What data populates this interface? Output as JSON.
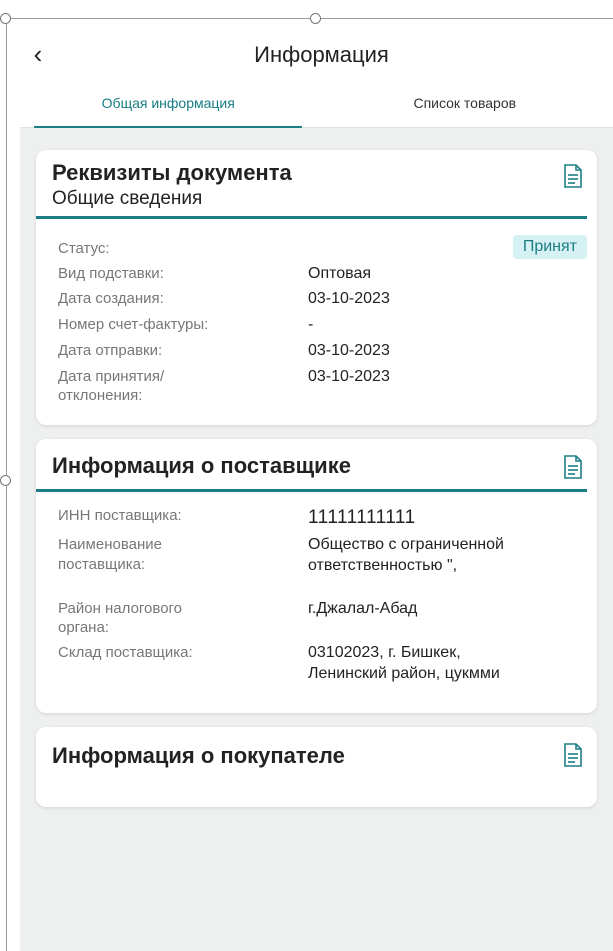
{
  "header": {
    "back_glyph": "‹",
    "title": "Информация"
  },
  "tabs": [
    {
      "label": "Общая информация",
      "active": true
    },
    {
      "label": "Список товаров",
      "active": false
    }
  ],
  "document_card": {
    "title": "Реквизиты документа",
    "subtitle": "Общие сведения",
    "icon": "document-icon",
    "status_label": "Статус:",
    "status_value": "Принят",
    "rows": [
      {
        "label": "Вид подставки:",
        "value": "Оптовая"
      },
      {
        "label": "Дата создания:",
        "value": "03-10-2023"
      },
      {
        "label": "Номер счет-фактуры:",
        "value": "-"
      },
      {
        "label": "Дата отправки:",
        "value": "03-10-2023"
      },
      {
        "label": "Дата принятия/ отклонения:",
        "value": "03-10-2023"
      }
    ]
  },
  "supplier_card": {
    "title": "Информация о поставщике",
    "icon": "document-icon",
    "rows": [
      {
        "label": "ИНН поставщика:",
        "value": "11111111111"
      },
      {
        "label": "Наименование поставщика:",
        "value": "Общество с ограниченной ответственностью \","
      },
      {
        "label": "Район налогового органа:",
        "value": "г.Джалал-Абад"
      },
      {
        "label": "Склад поставщика:",
        "value": "03102023, г. Бишкек, Ленинский район, цукмми"
      }
    ]
  },
  "buyer_card": {
    "title": "Информация о покупателе",
    "icon": "document-icon"
  },
  "colors": {
    "accent": "#1d7e85",
    "badge_bg": "#d6f1f3",
    "content_bg": "#eef0f0"
  }
}
